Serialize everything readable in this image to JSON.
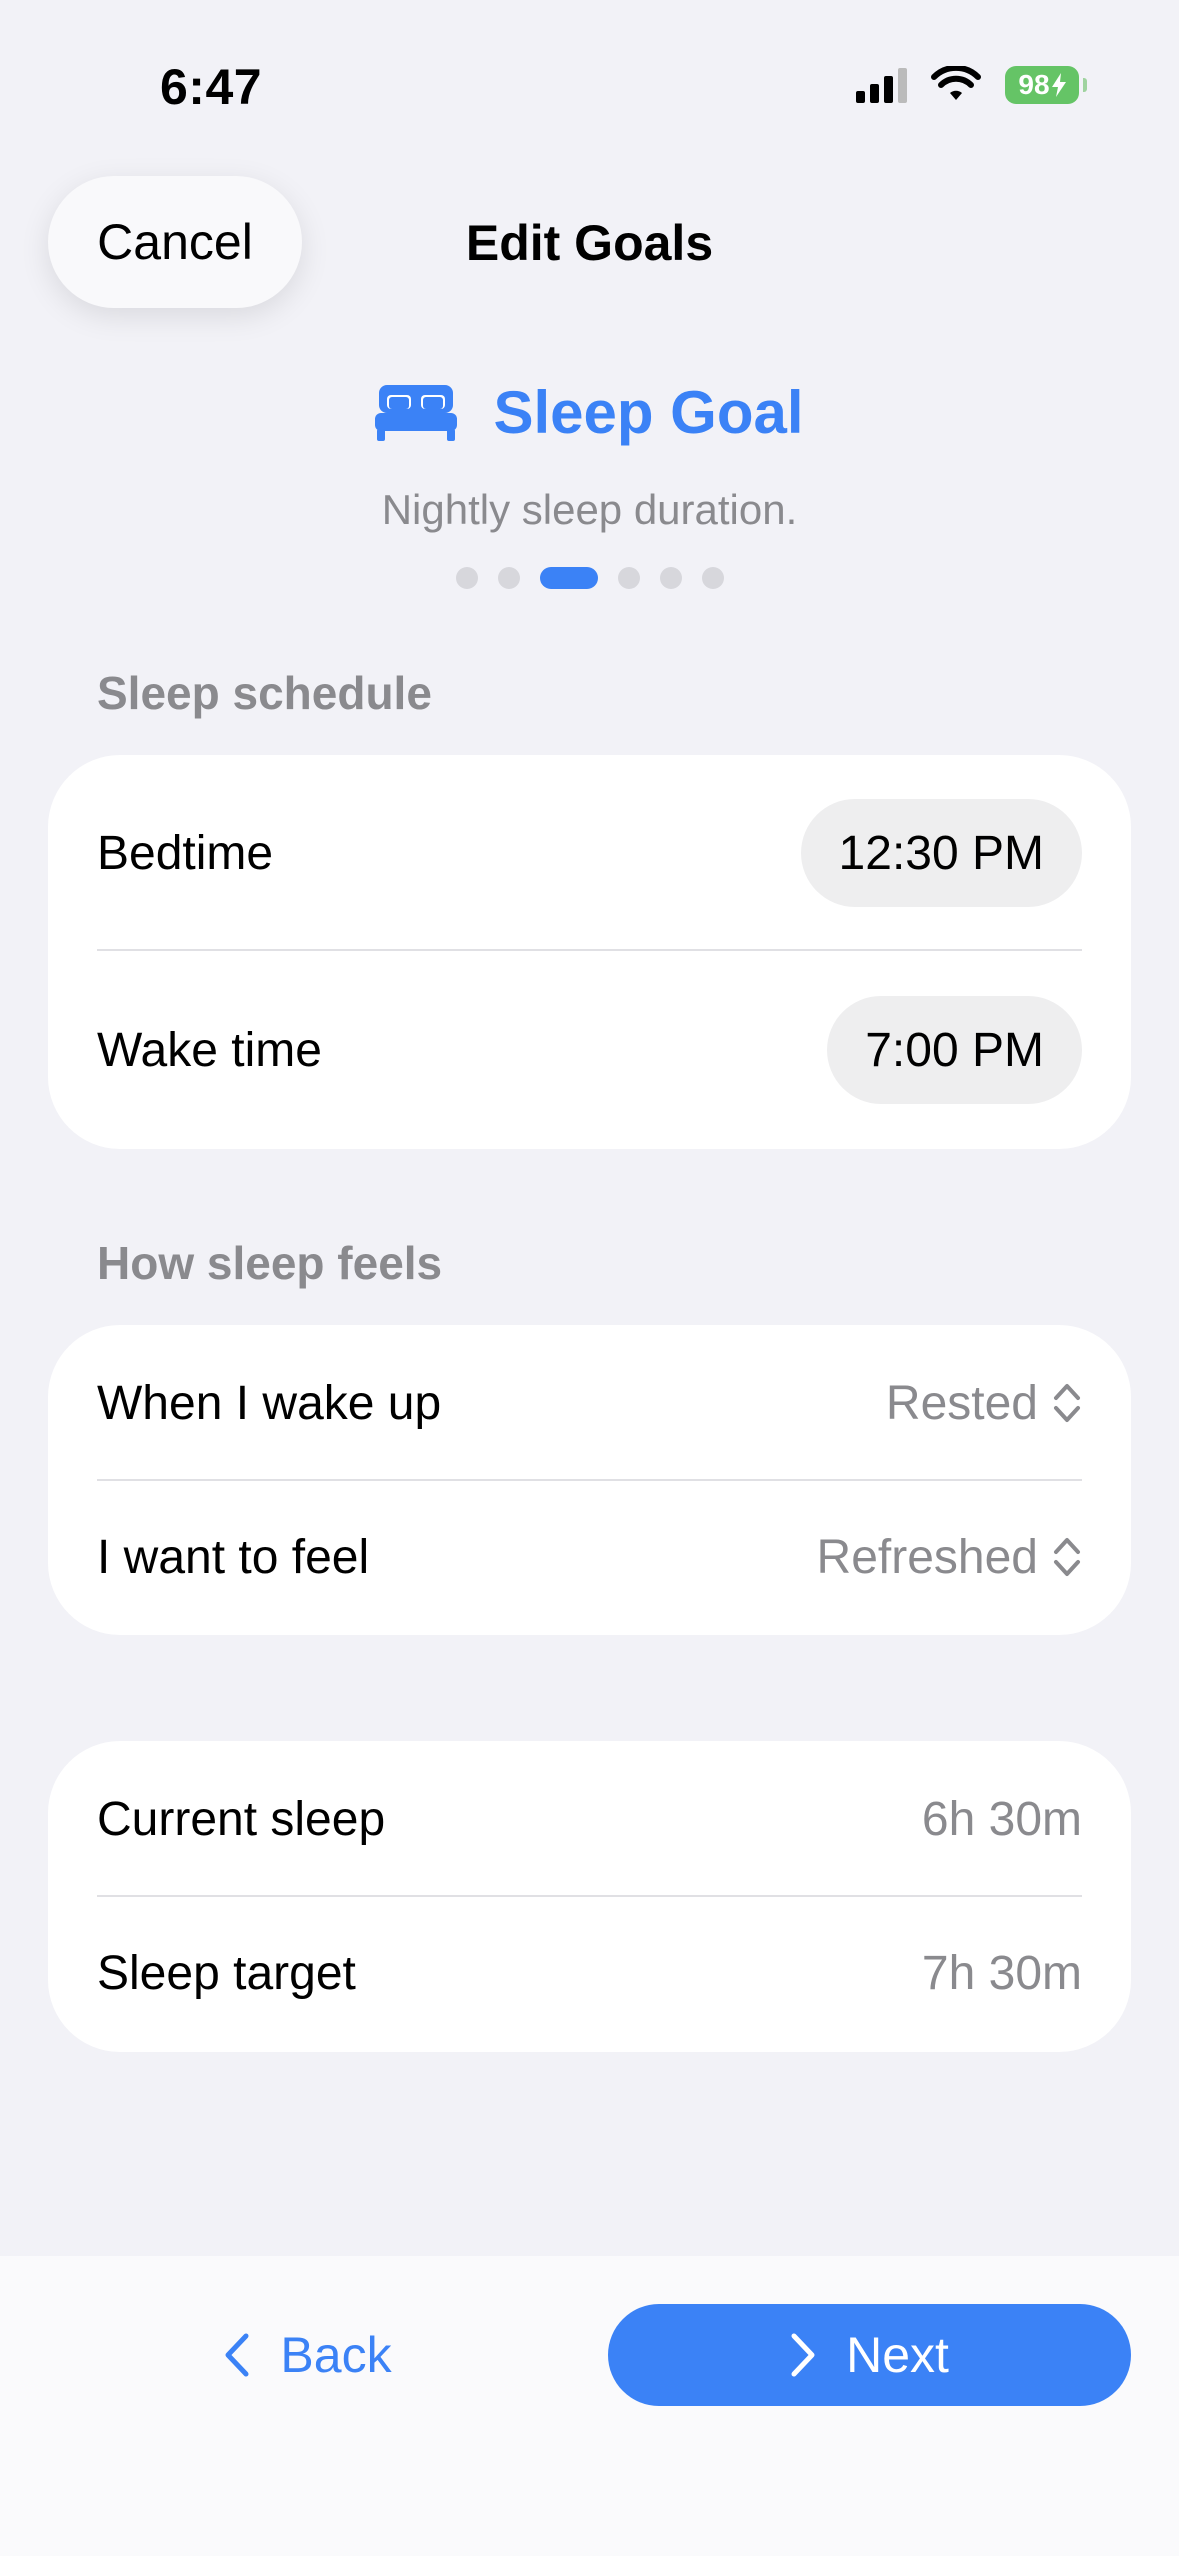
{
  "status_bar": {
    "time": "6:47",
    "battery": "98"
  },
  "header": {
    "cancel_label": "Cancel",
    "title": "Edit Goals"
  },
  "goal": {
    "icon": "bed-icon",
    "title": "Sleep Goal",
    "subtitle": "Nightly sleep duration.",
    "page_count": 6,
    "active_page": 3
  },
  "sleep_schedule": {
    "section_label": "Sleep schedule",
    "bedtime_label": "Bedtime",
    "bedtime_value": "12:30 PM",
    "waketime_label": "Wake time",
    "waketime_value": "7:00 PM"
  },
  "sleep_feel": {
    "section_label": "How sleep feels",
    "wake_label": "When I wake up",
    "wake_value": "Rested",
    "want_label": "I want to feel",
    "want_value": "Refreshed"
  },
  "summary": {
    "current_label": "Current sleep",
    "current_value": "6h 30m",
    "target_label": "Sleep target",
    "target_value": "7h 30m"
  },
  "footer": {
    "back_label": "Back",
    "next_label": "Next"
  },
  "colors": {
    "accent": "#3b82f6",
    "battery": "#65c466",
    "background": "#f2f2f7"
  }
}
